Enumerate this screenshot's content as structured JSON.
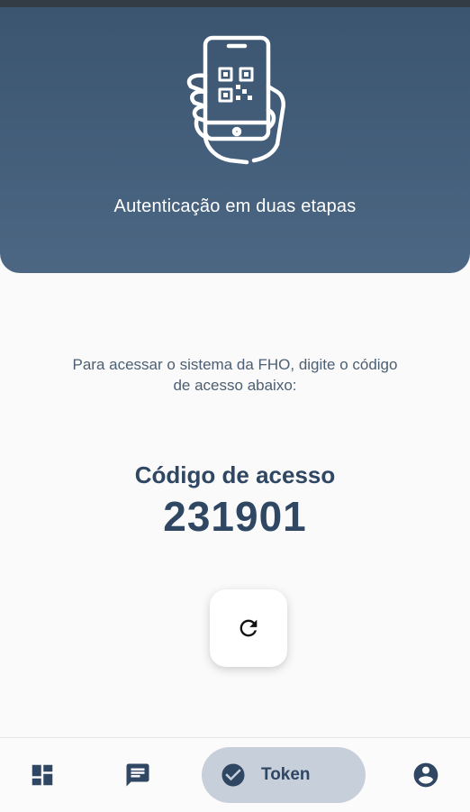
{
  "header": {
    "title": "Autenticação em duas etapas",
    "illustration_icon": "phone-qr-hand-icon",
    "background_color": "#4a6480"
  },
  "main": {
    "instruction_line1": "Para acessar o sistema da FHO, digite o código",
    "instruction_line2": "de acesso abaixo:",
    "code_label": "Código de acesso",
    "code_value": "231901",
    "refresh_icon": "refresh-icon",
    "accent_color": "#2f4763"
  },
  "bottom_nav": {
    "items": [
      {
        "icon": "dashboard-icon",
        "label": ""
      },
      {
        "icon": "chat-icon",
        "label": ""
      },
      {
        "icon": "check-circle-icon",
        "label": "Token",
        "active": true
      },
      {
        "icon": "account-icon",
        "label": ""
      }
    ],
    "active_pill_color": "#c7cfda"
  }
}
